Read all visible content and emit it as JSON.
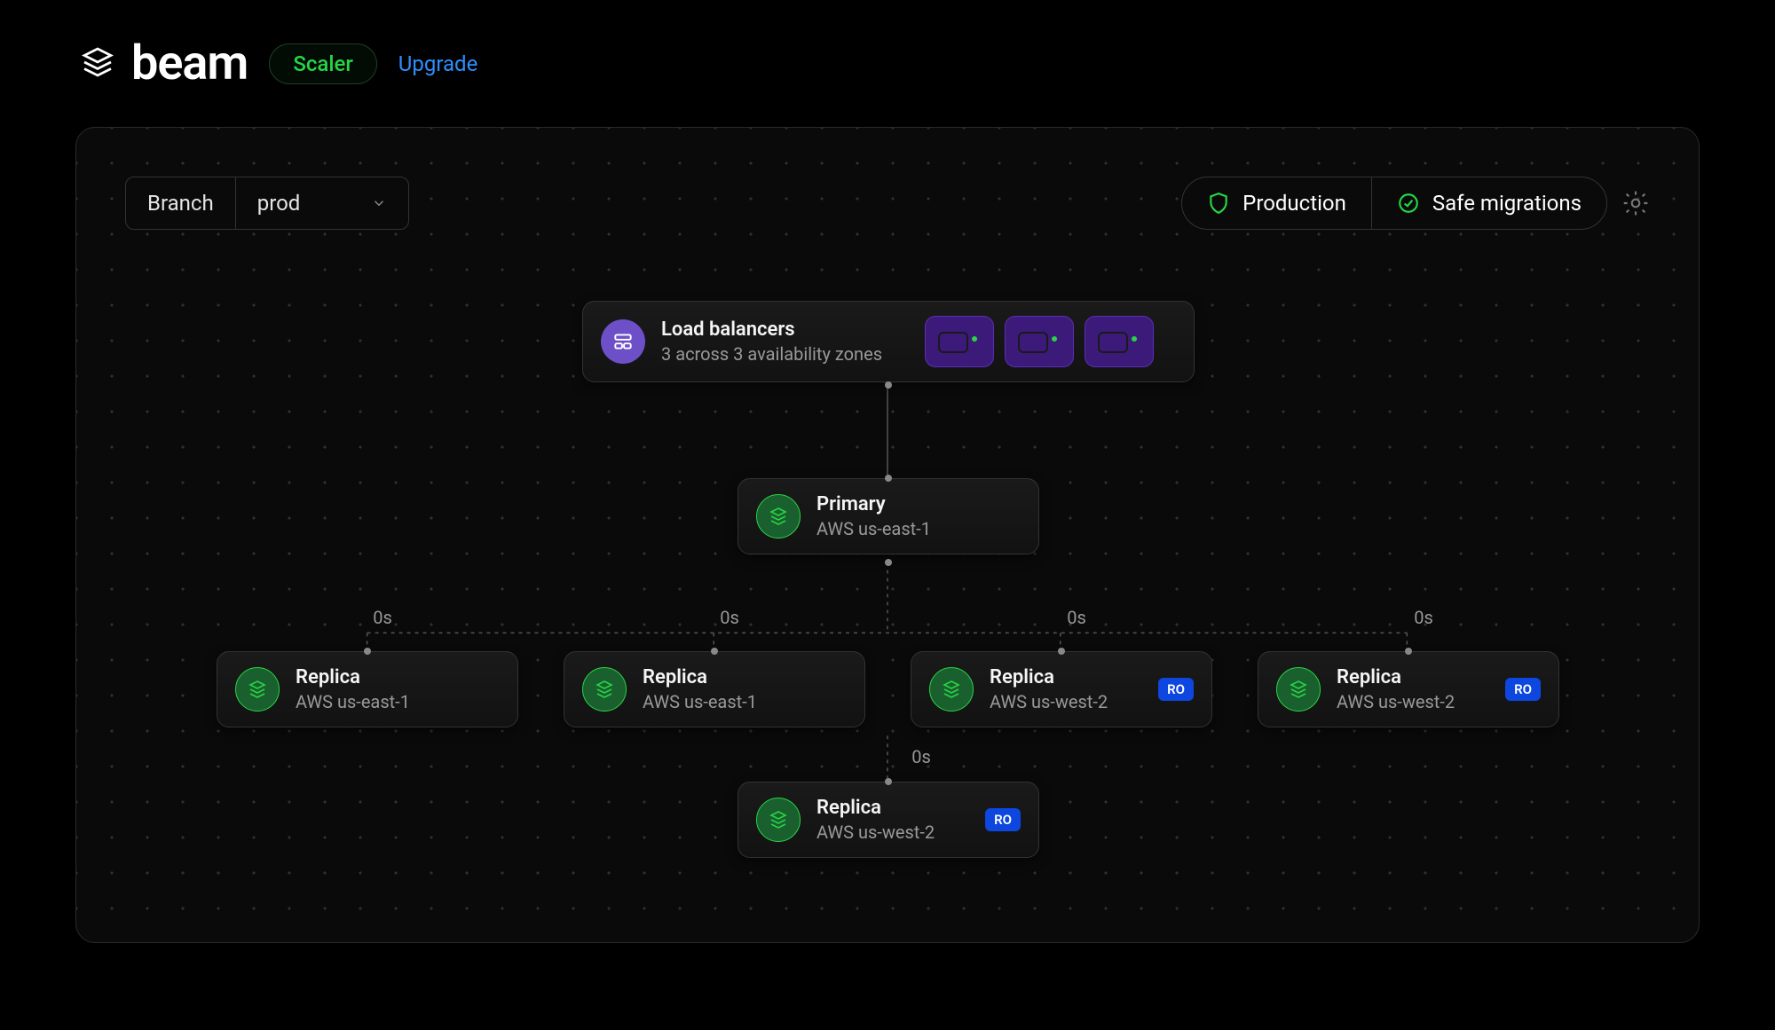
{
  "header": {
    "product": "beam",
    "plan_badge": "Scaler",
    "upgrade": "Upgrade"
  },
  "topbar": {
    "branch_label": "Branch",
    "branch_value": "prod",
    "status_production": "Production",
    "status_safe": "Safe migrations"
  },
  "lb": {
    "title": "Load balancers",
    "subtitle": "3 across 3 availability zones"
  },
  "primary": {
    "title": "Primary",
    "region": "AWS us-east-1"
  },
  "replicas": [
    {
      "title": "Replica",
      "region": "AWS us-east-1",
      "ro": false,
      "latency": "0s"
    },
    {
      "title": "Replica",
      "region": "AWS us-east-1",
      "ro": false,
      "latency": "0s"
    },
    {
      "title": "Replica",
      "region": "AWS us-west-2",
      "ro": true,
      "latency": "0s"
    },
    {
      "title": "Replica",
      "region": "AWS us-west-2",
      "ro": true,
      "latency": "0s"
    },
    {
      "title": "Replica",
      "region": "AWS us-west-2",
      "ro": true,
      "latency": "0s"
    }
  ],
  "ro_label": "RO",
  "colors": {
    "accent_green": "#27d545",
    "accent_blue": "#2c90ff",
    "purple": "#6d4fc7"
  }
}
